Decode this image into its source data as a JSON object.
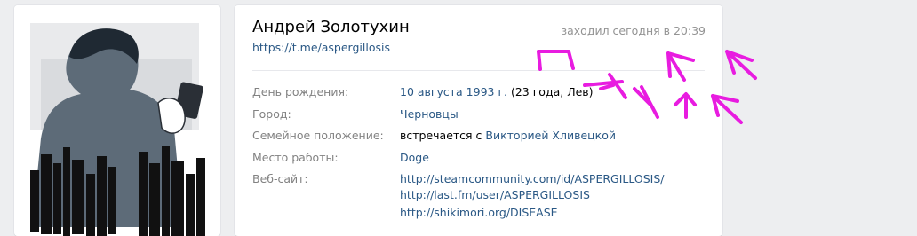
{
  "profile": {
    "name": "Андрей Золотухин",
    "status": "https://t.me/aspergillosis",
    "last_seen": "заходил сегодня в 20:39"
  },
  "info": {
    "birthday": {
      "label": "День рождения:",
      "date_link": "10 августа 1993 г.",
      "extra": "(23 года, Лев)"
    },
    "city": {
      "label": "Город:",
      "value": "Черновцы"
    },
    "relationship": {
      "label": "Семейное положение:",
      "prefix": "встречается с",
      "partner": "Викторией Хливецкой"
    },
    "work": {
      "label": "Место работы:",
      "value": "Doge"
    },
    "website": {
      "label": "Веб-сайт:",
      "links": [
        "http://steamcommunity.com/id/ASPERGILLOSIS/",
        "http://last.fm/user/ASPERGILLOSIS",
        "http://shikimori.org/DISEASE"
      ]
    }
  },
  "colors": {
    "link": "#2a5885",
    "label": "#828282",
    "muted": "#939393",
    "annotation": "#e81ce0",
    "background": "#edeef0"
  }
}
